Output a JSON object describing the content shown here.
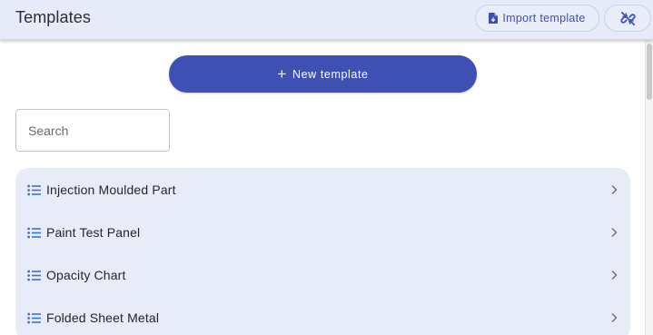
{
  "header": {
    "title": "Templates",
    "import_label": "Import template"
  },
  "actions": {
    "new_template_label": "New template"
  },
  "search": {
    "placeholder": "Search",
    "value": ""
  },
  "templates": [
    {
      "label": "Injection Moulded Part"
    },
    {
      "label": "Paint Test Panel"
    },
    {
      "label": "Opacity Chart"
    },
    {
      "label": "Folded Sheet Metal"
    }
  ],
  "colors": {
    "accent": "#3f50b5",
    "header_bg": "#e7eaf8",
    "list_bg": "#e8ebf8",
    "icon_blue": "#3f72c9"
  },
  "icons": {
    "import": "file-icon",
    "unlink": "unlink-icon",
    "item": "list-icon",
    "item_arrow": "chevron-right-icon"
  }
}
